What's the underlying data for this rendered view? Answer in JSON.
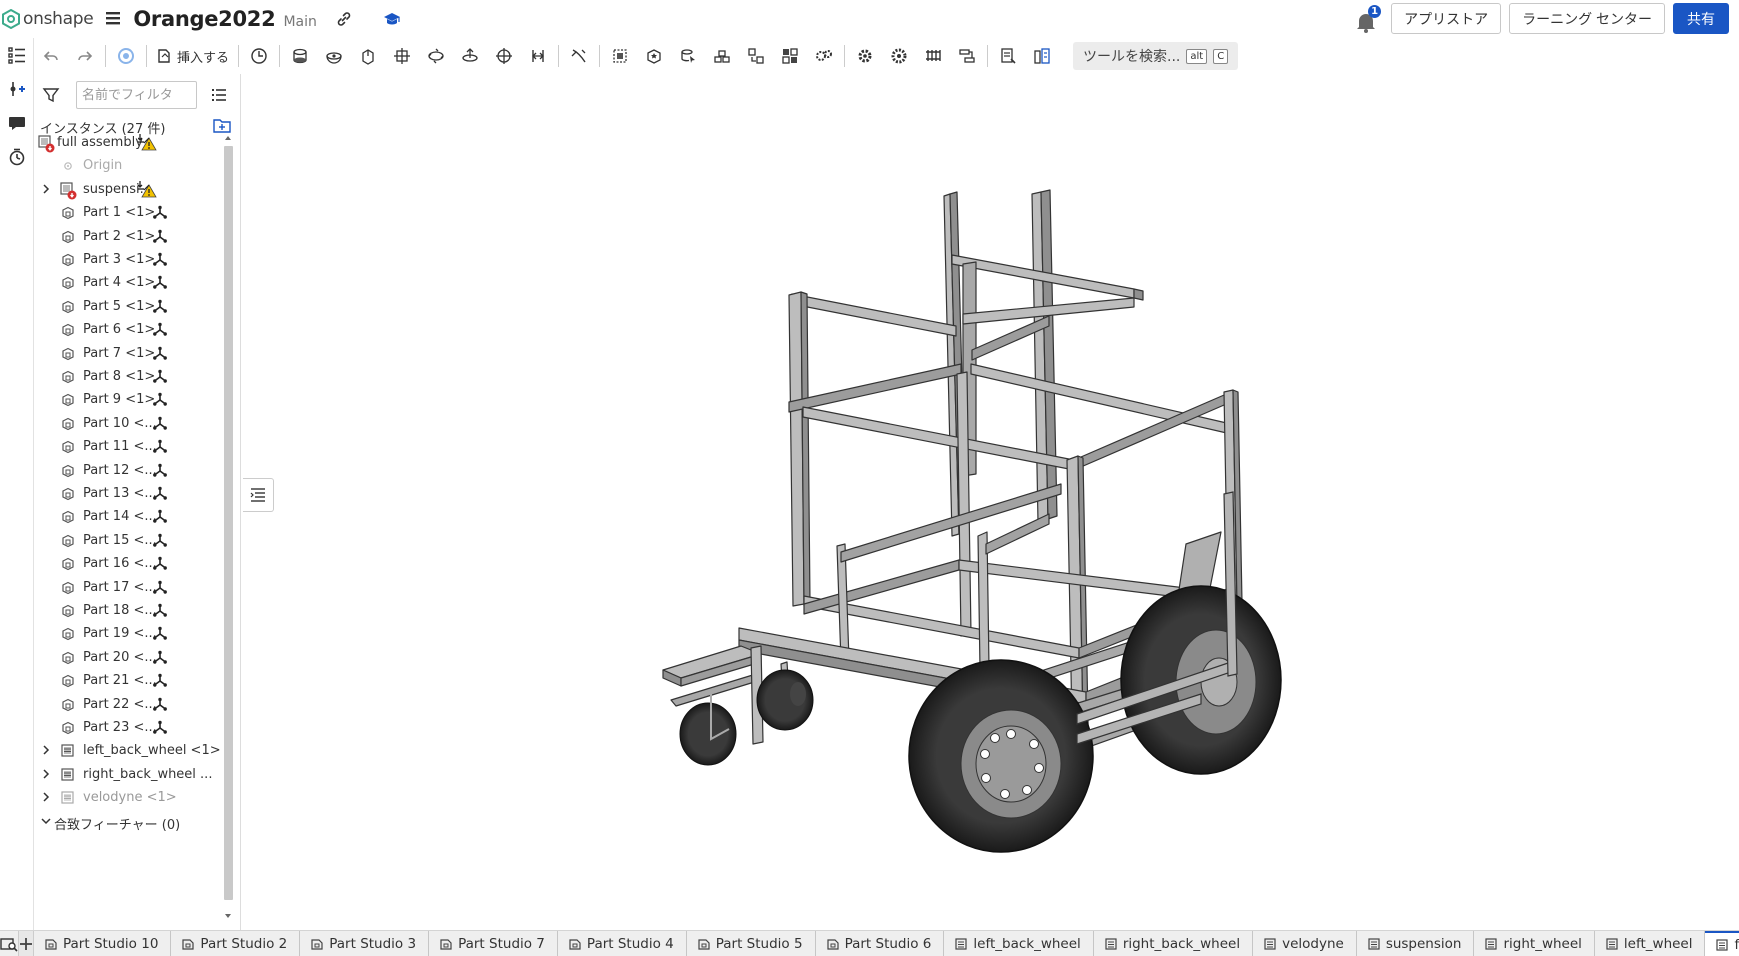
{
  "header": {
    "logo_text": "onshape",
    "doc_title": "Orange2022",
    "branch": "Main",
    "notification_count": "1",
    "app_store": "アプリストア",
    "learning_center": "ラーニング センター",
    "share": "共有"
  },
  "toolbar": {
    "insert_label": "挿入する",
    "search_label": "ツールを検索...",
    "kbd_alt": "alt",
    "kbd_c": "C"
  },
  "panel": {
    "filter_placeholder": "名前でフィルタ",
    "instances_label": "インスタンス (27 件)",
    "tree": [
      {
        "label": "full assembly",
        "type": "assembly",
        "chevron": false,
        "mate": "warn"
      },
      {
        "label": "Origin",
        "type": "origin",
        "chevron": false,
        "mate": "none"
      },
      {
        "label": "suspensi...",
        "type": "assembly",
        "chevron": true,
        "mate": "warn"
      },
      {
        "label": "Part 1 <1>",
        "type": "part",
        "chevron": false,
        "mate": "fixed"
      },
      {
        "label": "Part 2 <1>",
        "type": "part",
        "chevron": false,
        "mate": "fixed"
      },
      {
        "label": "Part 3 <1>",
        "type": "part",
        "chevron": false,
        "mate": "fixed"
      },
      {
        "label": "Part 4 <1>",
        "type": "part",
        "chevron": false,
        "mate": "fixed"
      },
      {
        "label": "Part 5 <1>",
        "type": "part",
        "chevron": false,
        "mate": "fixed"
      },
      {
        "label": "Part 6 <1>",
        "type": "part",
        "chevron": false,
        "mate": "fixed"
      },
      {
        "label": "Part 7 <1>",
        "type": "part",
        "chevron": false,
        "mate": "fixed"
      },
      {
        "label": "Part 8 <1>",
        "type": "part",
        "chevron": false,
        "mate": "fixed"
      },
      {
        "label": "Part 9 <1>",
        "type": "part",
        "chevron": false,
        "mate": "fixed"
      },
      {
        "label": "Part 10 <...",
        "type": "part",
        "chevron": false,
        "mate": "fixed"
      },
      {
        "label": "Part 11 <...",
        "type": "part",
        "chevron": false,
        "mate": "fixed"
      },
      {
        "label": "Part 12 <...",
        "type": "part",
        "chevron": false,
        "mate": "fixed"
      },
      {
        "label": "Part 13 <...",
        "type": "part",
        "chevron": false,
        "mate": "fixed"
      },
      {
        "label": "Part 14 <...",
        "type": "part",
        "chevron": false,
        "mate": "fixed"
      },
      {
        "label": "Part 15 <...",
        "type": "part",
        "chevron": false,
        "mate": "fixed"
      },
      {
        "label": "Part 16 <...",
        "type": "part",
        "chevron": false,
        "mate": "fixed"
      },
      {
        "label": "Part 17 <...",
        "type": "part",
        "chevron": false,
        "mate": "fixed"
      },
      {
        "label": "Part 18 <...",
        "type": "part",
        "chevron": false,
        "mate": "fixed"
      },
      {
        "label": "Part 19 <...",
        "type": "part",
        "chevron": false,
        "mate": "fixed"
      },
      {
        "label": "Part 20 <...",
        "type": "part",
        "chevron": false,
        "mate": "fixed"
      },
      {
        "label": "Part 21 <...",
        "type": "part",
        "chevron": false,
        "mate": "fixed"
      },
      {
        "label": "Part 22 <...",
        "type": "part",
        "chevron": false,
        "mate": "fixed"
      },
      {
        "label": "Part 23 <...",
        "type": "part",
        "chevron": false,
        "mate": "fixed"
      },
      {
        "label": "left_back_wheel <1>",
        "type": "subassembly",
        "chevron": true,
        "mate": "none"
      },
      {
        "label": "right_back_wheel ...",
        "type": "subassembly",
        "chevron": true,
        "mate": "none"
      },
      {
        "label": "velodyne <1>",
        "type": "subassembly-dim",
        "chevron": true,
        "mate": "none"
      },
      {
        "label": "合致フィーチャー (0)",
        "type": "section",
        "chevron": "down",
        "mate": "none"
      }
    ]
  },
  "bottom_tabs": [
    {
      "label": "Part Studio 10",
      "type": "studio"
    },
    {
      "label": "Part Studio 2",
      "type": "studio"
    },
    {
      "label": "Part Studio 3",
      "type": "studio"
    },
    {
      "label": "Part Studio 7",
      "type": "studio"
    },
    {
      "label": "Part Studio 4",
      "type": "studio"
    },
    {
      "label": "Part Studio 5",
      "type": "studio"
    },
    {
      "label": "Part Studio 6",
      "type": "studio"
    },
    {
      "label": "left_back_wheel",
      "type": "assembly"
    },
    {
      "label": "right_back_wheel",
      "type": "assembly"
    },
    {
      "label": "velodyne",
      "type": "assembly"
    },
    {
      "label": "suspension",
      "type": "assembly"
    },
    {
      "label": "right_wheel",
      "type": "assembly"
    },
    {
      "label": "left_wheel",
      "type": "assembly"
    },
    {
      "label": "fu",
      "type": "assembly",
      "active": true
    }
  ],
  "colors": {
    "accent": "#1a56c4",
    "warning": "#f2c200",
    "error": "#d32f2f",
    "brand_green": "#3dab8c"
  }
}
